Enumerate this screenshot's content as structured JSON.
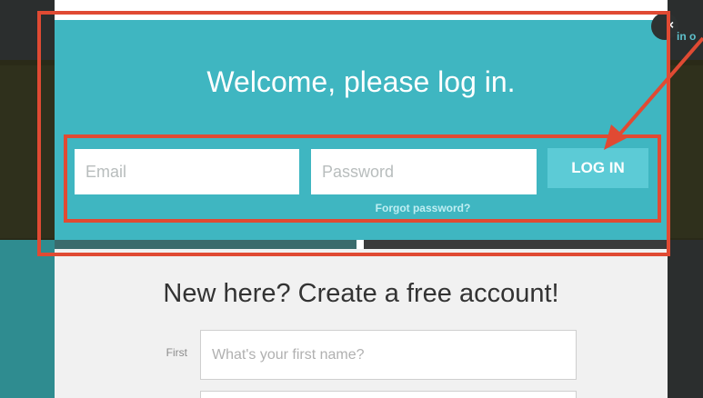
{
  "header": {
    "corner_text": "in o"
  },
  "modal": {
    "welcome": "Welcome, please log in.",
    "email_placeholder": "Email",
    "password_placeholder": "Password",
    "login_label": "LOG IN",
    "forgot_label": "Forgot password?",
    "close_label": "×"
  },
  "signup": {
    "title": "New here? Create a free account!",
    "first_label": "First",
    "first_placeholder": "What's your first name?"
  },
  "colors": {
    "modal_teal": "#3fb6c1",
    "button_teal": "#5ccbd6",
    "annotation_red": "#e04a33"
  },
  "icons": {
    "close": "close-icon"
  }
}
